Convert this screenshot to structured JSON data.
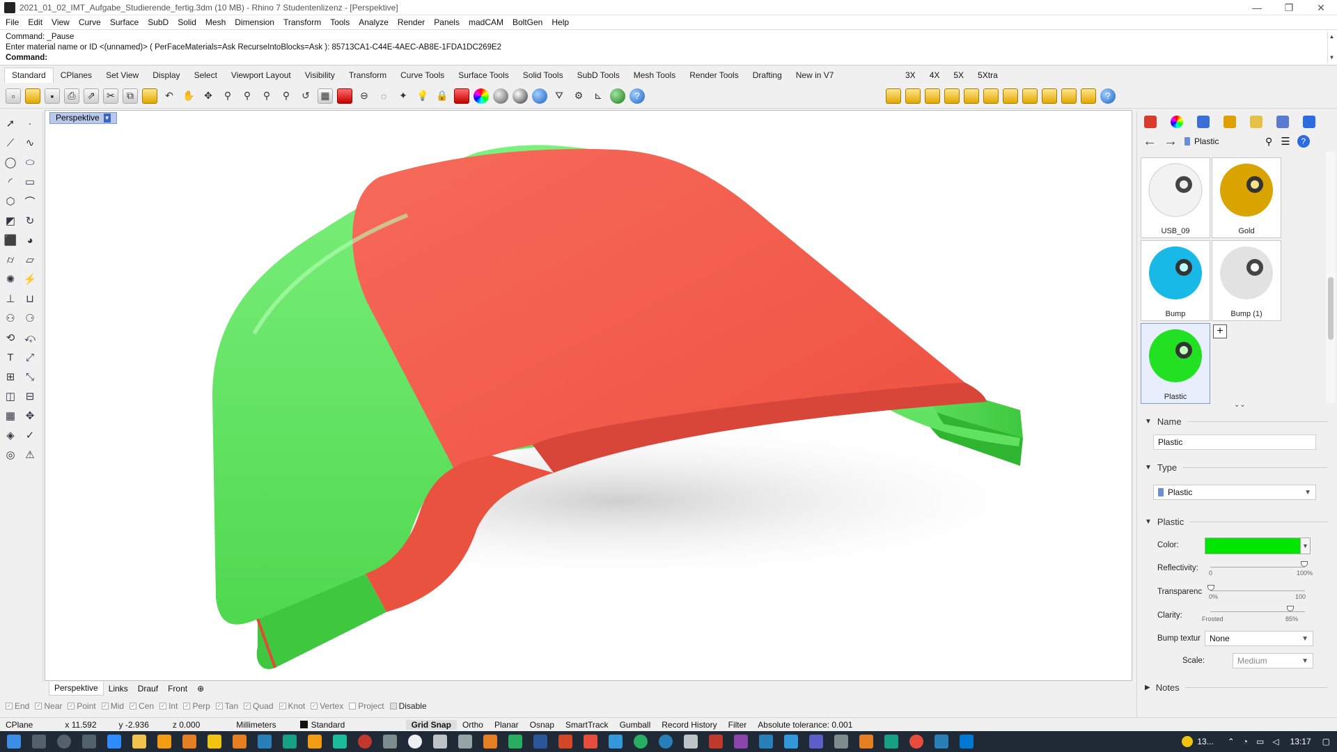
{
  "window": {
    "title": "2021_01_02_IMT_Aufgabe_Studierende_fertig.3dm (10 MB) - Rhino 7 Studentenlizenz - [Perspektive]",
    "minimize": "—",
    "maximize": "❐",
    "close": "✕"
  },
  "menu": [
    "File",
    "Edit",
    "View",
    "Curve",
    "Surface",
    "SubD",
    "Solid",
    "Mesh",
    "Dimension",
    "Transform",
    "Tools",
    "Analyze",
    "Render",
    "Panels",
    "madCAM",
    "BoltGen",
    "Help"
  ],
  "command": {
    "line1": "Command: _Pause",
    "line2": "Enter material name or ID <(unnamed)> ( PerFaceMaterials=Ask  RecurseIntoBlocks=Ask ): 85713CA1-C44E-4AEC-AB8E-1FDA1DC269E2",
    "prompt": "Command:"
  },
  "toolbar_tabs": [
    "Standard",
    "CPlanes",
    "Set View",
    "Display",
    "Select",
    "Viewport Layout",
    "Visibility",
    "Transform",
    "Curve Tools",
    "Surface Tools",
    "Solid Tools",
    "SubD Tools",
    "Mesh Tools",
    "Render Tools",
    "Drafting",
    "New in V7"
  ],
  "toolbar_tabs2": [
    "3X",
    "4X",
    "5X",
    "5Xtra"
  ],
  "viewport": {
    "title": "Perspektive",
    "dropdown": "▼"
  },
  "viewport_tabs": [
    "Perspektive",
    "Links",
    "Drauf",
    "Front"
  ],
  "viewport_tab_add": "⊕",
  "osnaps": [
    {
      "label": "End",
      "checked": false
    },
    {
      "label": "Near",
      "checked": false
    },
    {
      "label": "Point",
      "checked": false
    },
    {
      "label": "Mid",
      "checked": false
    },
    {
      "label": "Cen",
      "checked": false
    },
    {
      "label": "Int",
      "checked": false
    },
    {
      "label": "Perp",
      "checked": false
    },
    {
      "label": "Tan",
      "checked": false
    },
    {
      "label": "Quad",
      "checked": false
    },
    {
      "label": "Knot",
      "checked": false
    },
    {
      "label": "Vertex",
      "checked": false
    },
    {
      "label": "Project",
      "checked": false
    },
    {
      "label": "Disable",
      "checked": false
    }
  ],
  "status": {
    "cplane": "CPlane",
    "x": "x 11.592",
    "y": "y -2.936",
    "z": "z 0.000",
    "units": "Millimeters",
    "layer": "Standard",
    "grid_snap": "Grid Snap",
    "ortho": "Ortho",
    "planar": "Planar",
    "osnap": "Osnap",
    "smarttrack": "SmartTrack",
    "gumball": "Gumball",
    "record_history": "Record History",
    "filter": "Filter",
    "tolerance": "Absolute tolerance: 0.001"
  },
  "materials_panel": {
    "breadcrumb": "Plastic",
    "materials": [
      {
        "name": "USB_09",
        "color": "#f2f2f2"
      },
      {
        "name": "Gold",
        "color": "#d9a400"
      },
      {
        "name": "Bump",
        "color": "#18b9e6"
      },
      {
        "name": "Bump (1)",
        "color": "#e6e6e6"
      },
      {
        "name": "Plastic",
        "color": "#22e022"
      }
    ],
    "add_button": "+",
    "expander": "⌄⌄",
    "section_name": "Name",
    "name_value": "Plastic",
    "section_type": "Type",
    "type_value": "Plastic",
    "section_plastic": "Plastic",
    "color_label": "Color:",
    "color_value": "#00e600",
    "reflectivity_label": "Reflectivity:",
    "reflectivity_min": "0",
    "reflectivity_max": "100%",
    "reflectivity_value": 1.0,
    "transparency_label": "Transparenc",
    "transparency_min": "0%",
    "transparency_max": "100",
    "transparency_value": 0.0,
    "clarity_label": "Clarity:",
    "clarity_min": "Frosted",
    "clarity_max": "85%",
    "clarity_value": 0.85,
    "bump_label": "Bump textur",
    "bump_value": "None",
    "scale_label": "Scale:",
    "scale_value": "Medium",
    "section_notes": "Notes"
  },
  "taskbar": {
    "time": "13:17",
    "weather": "13..."
  }
}
